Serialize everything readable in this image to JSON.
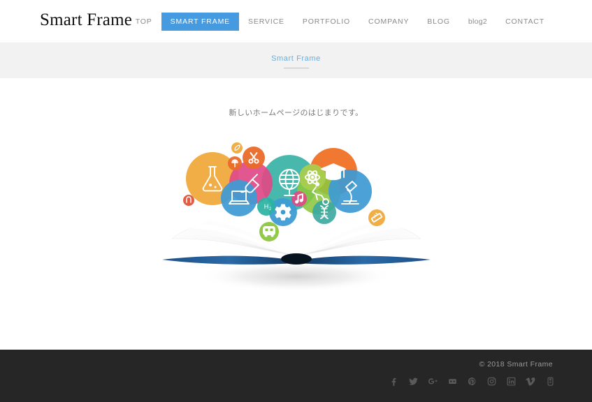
{
  "header": {
    "logo": "Smart Frame",
    "nav": [
      {
        "label": "TOP",
        "active": false,
        "lowercase": false
      },
      {
        "label": "SMART FRAME",
        "active": true,
        "lowercase": false
      },
      {
        "label": "SERVICE",
        "active": false,
        "lowercase": false
      },
      {
        "label": "PORTFOLIO",
        "active": false,
        "lowercase": false
      },
      {
        "label": "COMPANY",
        "active": false,
        "lowercase": false
      },
      {
        "label": "BLOG",
        "active": false,
        "lowercase": false
      },
      {
        "label": "blog2",
        "active": false,
        "lowercase": true
      },
      {
        "label": "CONTACT",
        "active": false,
        "lowercase": false
      }
    ]
  },
  "banner": {
    "title": "Smart Frame"
  },
  "main": {
    "lead_text": "新しいホームページのはじまりです。",
    "hero_alt": "open-book-with-education-icons"
  },
  "hero_icons": [
    {
      "name": "flask-icon",
      "color": "#f0a93c",
      "label": "flask"
    },
    {
      "name": "scissors-icon",
      "color": "#ea6a2a",
      "label": "scissors"
    },
    {
      "name": "paint-icon",
      "color": "#e04a87",
      "label": "paint-brush"
    },
    {
      "name": "globe-icon",
      "color": "#3ab3a6",
      "label": "globe"
    },
    {
      "name": "atom-icon",
      "color": "#a9ce4e",
      "label": "atom"
    },
    {
      "name": "graduation-icon",
      "color": "#ef7126",
      "label": "graduation-cap"
    },
    {
      "name": "soccer-icon",
      "color": "#8cc63f",
      "label": "soccer-player"
    },
    {
      "name": "microscope-icon",
      "color": "#3e9bd4",
      "label": "microscope"
    },
    {
      "name": "laptop-icon",
      "color": "#3e9bd4",
      "label": "laptop"
    },
    {
      "name": "gear-icon",
      "color": "#3e9bd4",
      "label": "gear"
    },
    {
      "name": "h2o-icon",
      "color": "#2bb3a3",
      "label": "h2o"
    },
    {
      "name": "dna-icon",
      "color": "#3aa9a0",
      "label": "dna"
    },
    {
      "name": "bus-icon",
      "color": "#8cc63f",
      "label": "school-bus"
    },
    {
      "name": "ruler-icon",
      "color": "#f0a93c",
      "label": "ruler"
    },
    {
      "name": "music-icon",
      "color": "#e04a87",
      "label": "music-note"
    },
    {
      "name": "push-pin-icon",
      "color": "#ea6a2a",
      "label": "push-pin"
    },
    {
      "name": "magnet-icon",
      "color": "#e2543b",
      "label": "magnet"
    },
    {
      "name": "leaf-icon",
      "color": "#f0a93c",
      "label": "leaf"
    }
  ],
  "footer": {
    "copyright": "© 2018 Smart Frame",
    "social": [
      {
        "name": "facebook-icon",
        "label": "Facebook"
      },
      {
        "name": "twitter-icon",
        "label": "Twitter"
      },
      {
        "name": "googleplus-icon",
        "label": "Google Plus"
      },
      {
        "name": "flickr-icon",
        "label": "Flickr"
      },
      {
        "name": "pinterest-icon",
        "label": "Pinterest"
      },
      {
        "name": "instagram-icon",
        "label": "Instagram"
      },
      {
        "name": "linkedin-icon",
        "label": "LinkedIn"
      },
      {
        "name": "vimeo-icon",
        "label": "Vimeo"
      },
      {
        "name": "youtube-icon",
        "label": "YouTube"
      }
    ]
  },
  "colors": {
    "accent_blue": "#459ae0",
    "banner_bg": "#f2f2f2",
    "footer_bg": "#262626",
    "nav_text": "#8b8b8b"
  }
}
